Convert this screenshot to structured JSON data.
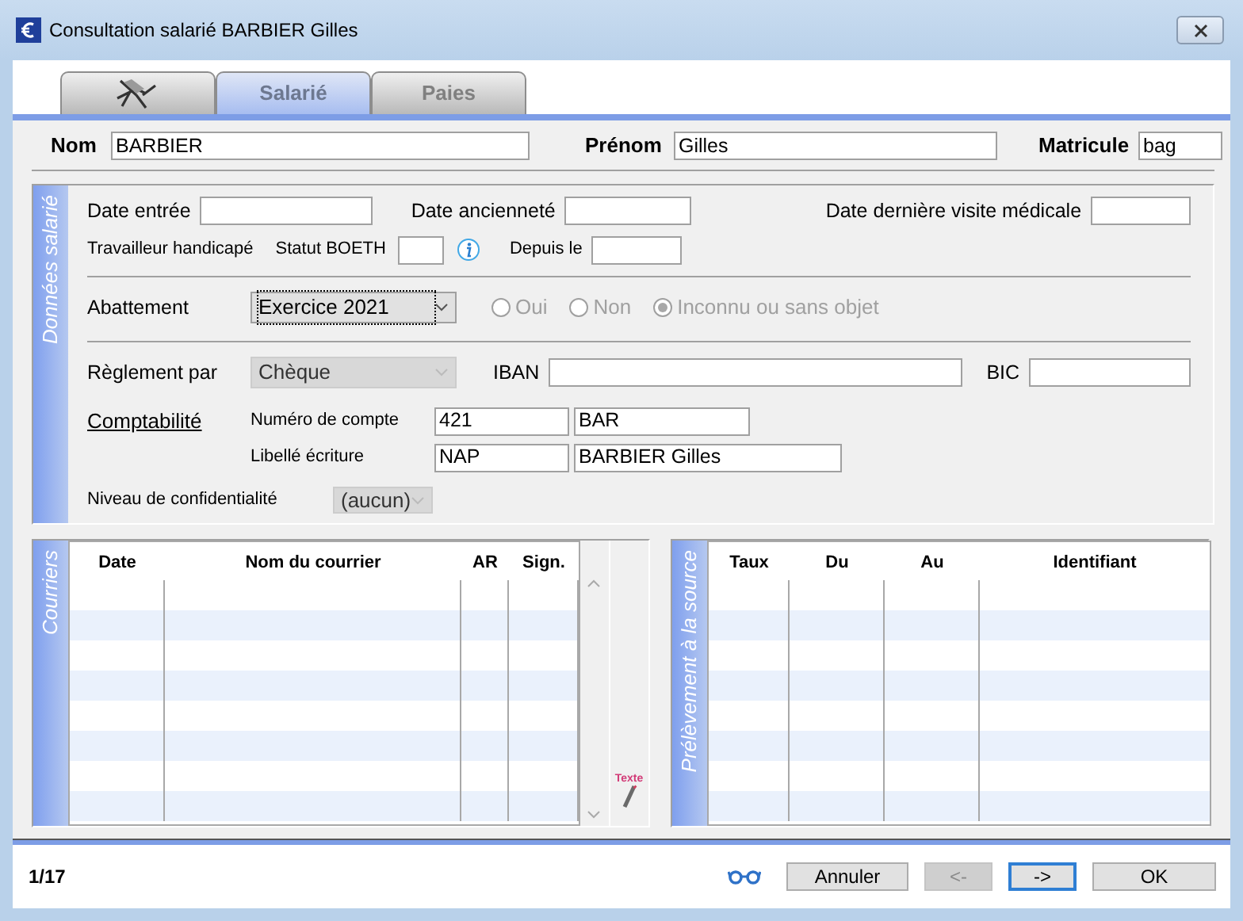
{
  "window": {
    "title": "Consultation salarié BARBIER Gilles"
  },
  "tabs": [
    {
      "kind": "icon",
      "selected": false
    },
    {
      "kind": "text",
      "label": "Salarié",
      "selected": true
    },
    {
      "kind": "text",
      "label": "Paies",
      "selected": false
    }
  ],
  "identity": [
    {
      "label": "Nom",
      "value": "BARBIER"
    },
    {
      "label": "Prénom",
      "value": "Gilles"
    },
    {
      "label": "Matricule",
      "value": "bag"
    }
  ],
  "donnees_salarie": {
    "title": "Données salarié",
    "dates": [
      "Date entrée",
      "Date ancienneté",
      "Date dernière visite médicale"
    ],
    "handicap": {
      "label": "Travailleur handicapé",
      "statut_label": "Statut BOETH",
      "depuis_label": "Depuis le"
    },
    "abattement": {
      "label": "Abattement",
      "value": "Exercice 2021",
      "disabled": false,
      "options": [
        {
          "label": "Oui",
          "selected": false,
          "disabled": true
        },
        {
          "label": "Non",
          "selected": false,
          "disabled": true
        },
        {
          "label": "Inconnu ou sans objet",
          "selected": true,
          "disabled": true
        }
      ]
    },
    "reglement": {
      "label": "Règlement par",
      "value": "Chèque",
      "disabled": true
    },
    "iban": {
      "label": "IBAN"
    },
    "bic": {
      "label": "BIC"
    },
    "comptabilite": {
      "link": "Comptabilité",
      "numero_label": "Numéro de compte",
      "numero_values": [
        "421",
        "BAR"
      ],
      "libelle_label": "Libellé écriture",
      "libelle_values": [
        "NAP",
        "BARBIER Gilles"
      ]
    },
    "confidentialite": {
      "label": "Niveau de confidentialité",
      "value": "(aucun)",
      "disabled": true
    }
  },
  "courriers": {
    "title": "Courriers",
    "columns": [
      "Date",
      "Nom du courrier",
      "AR",
      "Sign."
    ],
    "texte_button": "Texte"
  },
  "prelevement": {
    "title": "Prélèvement à la source",
    "columns": [
      "Taux",
      "Du",
      "Au",
      "Identifiant"
    ]
  },
  "footer": {
    "counter": "1/17",
    "buttons": [
      {
        "label": "Annuler",
        "disabled": false,
        "focused": false
      },
      {
        "label": "<-",
        "disabled": true,
        "focused": false
      },
      {
        "label": "->",
        "disabled": false,
        "focused": true
      },
      {
        "label": "OK",
        "disabled": false,
        "focused": false
      }
    ]
  }
}
